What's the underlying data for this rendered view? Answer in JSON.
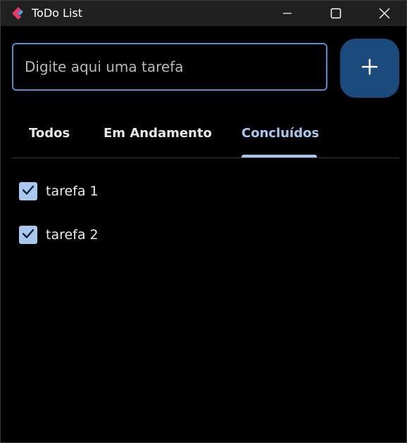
{
  "window": {
    "title": "ToDo List",
    "icon": "flutter-logo-icon",
    "controls": [
      "minimize-icon",
      "maximize-icon",
      "close-icon"
    ]
  },
  "input": {
    "placeholder": "Digite aqui uma tarefa",
    "value": ""
  },
  "add_button": {
    "icon": "plus-icon"
  },
  "tabs": [
    {
      "label": "Todos",
      "selected": false
    },
    {
      "label": "Em Andamento",
      "selected": false
    },
    {
      "label": "Concluídos",
      "selected": true
    }
  ],
  "tasks": [
    {
      "label": "tarefa 1",
      "checked": true
    },
    {
      "label": "tarefa 2",
      "checked": true
    }
  ],
  "colors": {
    "background": "#000000",
    "titlebar": "#202020",
    "accent": "#a8c8f0",
    "input_border": "#4a90d6",
    "add_button": "#1b4a7c"
  }
}
